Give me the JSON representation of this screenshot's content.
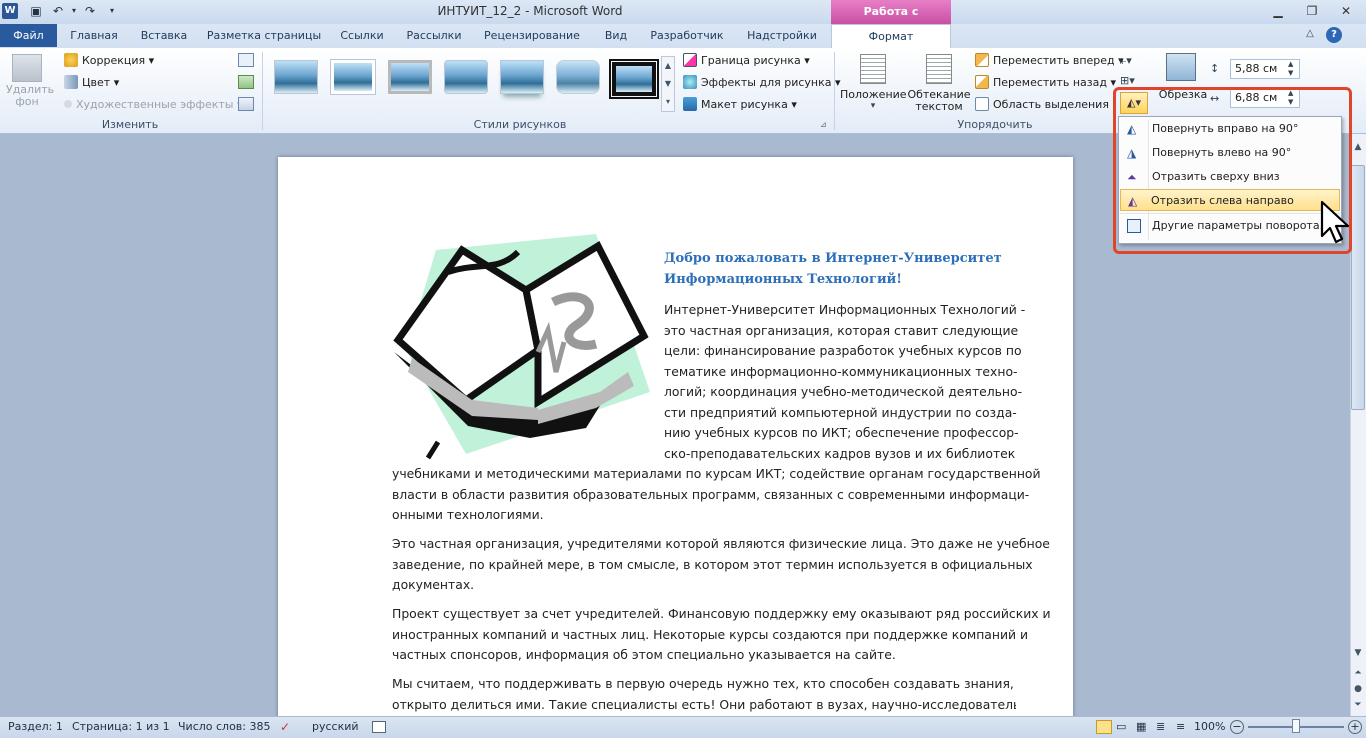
{
  "titlebar": {
    "title": "ИНТУИТ_12_2 - Microsoft Word",
    "context_header": "Работа с рисунками",
    "app_letter": "W"
  },
  "tabs": {
    "file": "Файл",
    "items": [
      "Главная",
      "Вставка",
      "Разметка страницы",
      "Ссылки",
      "Рассылки",
      "Рецензирование",
      "Вид",
      "Разработчик",
      "Надстройки"
    ],
    "format": "Формат"
  },
  "ribbon": {
    "remove_bg": "Удалить\nфон",
    "remove_bg_l1": "Удалить",
    "remove_bg_l2": "фон",
    "correction": "Коррекция",
    "color": "Цвет",
    "art_effects": "Художественные эффекты",
    "group_change": "Изменить",
    "border": "Граница рисунка",
    "effects": "Эффекты для рисунка",
    "layout": "Макет рисунка",
    "group_styles": "Стили рисунков",
    "position_l1": "Положение",
    "wrap_l1": "Обтекание",
    "wrap_l2": "текстом",
    "bring_forward": "Переместить вперед",
    "send_backward": "Переместить назад",
    "selection_pane": "Область выделения",
    "group_arrange": "Упорядочить",
    "crop": "Обрезка",
    "height": "5,88 см",
    "width": "6,88 см"
  },
  "rotate_menu": {
    "items": [
      "Повернуть вправо на 90°",
      "Повернуть влево на 90°",
      "Отразить сверху вниз",
      "Отразить слева направо",
      "Другие параметры поворота..."
    ]
  },
  "document": {
    "heading": "Добро пожаловать в Интернет-Университет Информационных Технологий!",
    "p1_lines": [
      "Интернет-Университет Информационных Технологий -",
      "это частная организация, которая ставит следующие",
      "цели:  финансирование разработок учебных курсов по",
      "тематике информационно-коммуникационных техно-",
      "логий; координация учебно-методической деятельно-",
      "сти предприятий компьютерной индустрии по созда-",
      "нию учебных курсов по ИКТ; обеспечение профессор-",
      "ско-преподавательских кадров вузов и их библиотек"
    ],
    "p1_rest": [
      "учебниками и методическими материалами по курсам ИКТ; содействие органам государственной",
      "власти в области развития образовательных программ, связанных с современными информаци-",
      "онными технологиями."
    ],
    "p2": [
      "Это частная организация, учредителями которой являются физические лица. Это даже не учебное",
      "заведение, по крайней мере, в том смысле, в котором этот термин используется в официальных",
      "документах."
    ],
    "p3": [
      "Проект существует за счет учредителей. Финансовую поддержку ему оказывают ряд российских и",
      "иностранных компаний и частных лиц. Некоторые курсы создаются при поддержке компаний и",
      "частных спонсоров, информация об этом специально указывается на сайте."
    ],
    "p4": [
      "Мы считаем, что поддерживать в первую очередь нужно тех, кто способен создавать знания, и",
      "открыто делиться ими. Такие специалисты есть! Они работают в вузах, научно-исследовательских"
    ]
  },
  "status": {
    "section": "Раздел: 1",
    "page": "Страница: 1 из 1",
    "words": "Число слов: 385",
    "language": "русский",
    "zoom": "100%"
  }
}
